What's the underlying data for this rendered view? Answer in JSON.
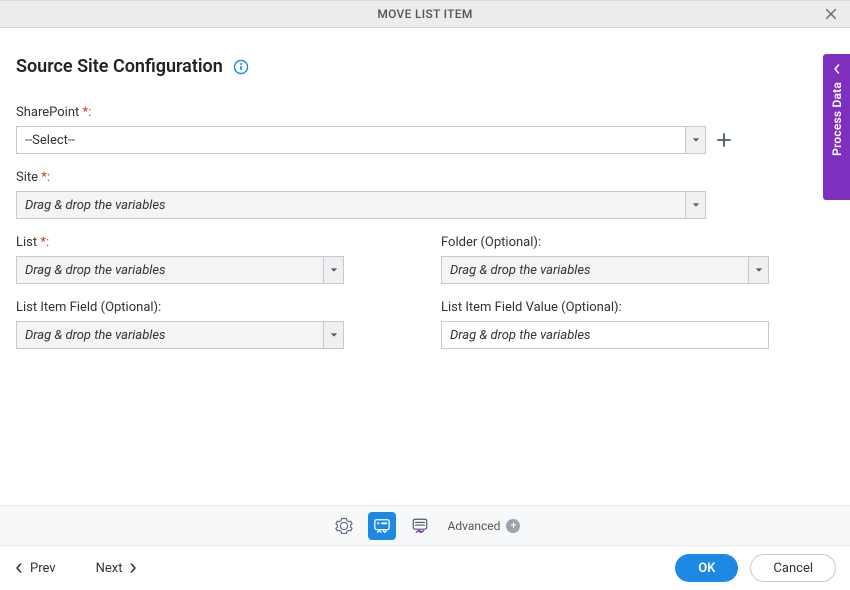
{
  "header": {
    "title": "MOVE LIST ITEM"
  },
  "page": {
    "title": "Source Site Configuration"
  },
  "fields": {
    "sharepoint": {
      "label": "SharePoint",
      "required_suffix": " *:",
      "value": "--Select--"
    },
    "site": {
      "label": "Site",
      "required_suffix": " *:",
      "placeholder": "Drag & drop the variables"
    },
    "list": {
      "label": "List",
      "required_suffix": " *:",
      "placeholder": "Drag & drop the variables"
    },
    "folder": {
      "label": "Folder (Optional):",
      "placeholder": "Drag & drop the variables"
    },
    "item_field": {
      "label": "List Item Field (Optional):",
      "placeholder": "Drag & drop the variables"
    },
    "item_value": {
      "label": "List Item Field Value (Optional):",
      "placeholder": "Drag & drop the variables"
    }
  },
  "sidebar": {
    "tab_label": "Process Data"
  },
  "toolbar": {
    "advanced_label": "Advanced"
  },
  "footer": {
    "prev": "Prev",
    "next": "Next",
    "ok": "OK",
    "cancel": "Cancel"
  }
}
